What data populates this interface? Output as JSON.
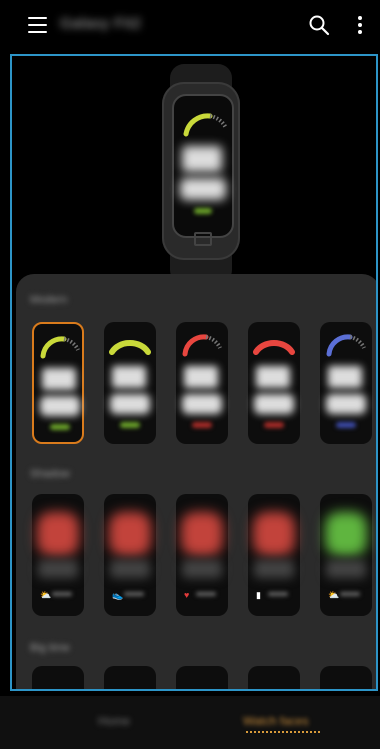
{
  "appbar": {
    "title": "Galaxy Fit2",
    "menu_icon": "hamburger-menu-icon",
    "search_icon": "search-icon",
    "more_icon": "more-vertical-icon"
  },
  "preview": {
    "time_top": "10",
    "time_bottom": "08",
    "accent": "#c9d93a"
  },
  "sections": [
    {
      "title": "Modern",
      "faces": [
        {
          "accent": "#c9d93a",
          "bar": "#6aa12a",
          "selected": true
        },
        {
          "accent": "#c9d93a",
          "bar": "#6aa12a",
          "selected": false
        },
        {
          "accent": "#e8463f",
          "bar": "#a82c28",
          "selected": false
        },
        {
          "accent": "#e8463f",
          "bar": "#a82c28",
          "selected": false
        },
        {
          "accent": "#5b6fd6",
          "bar": "#3c4aa8",
          "selected": false
        }
      ]
    },
    {
      "title": "Shadow",
      "faces": [
        {
          "blob": "#c2433b",
          "icon": "weather-icon",
          "glyph": "⛅"
        },
        {
          "blob": "#c2433b",
          "icon": "steps-icon",
          "glyph": "👟"
        },
        {
          "blob": "#c2433b",
          "icon": "heart-icon",
          "glyph": "♥"
        },
        {
          "blob": "#c2433b",
          "icon": "battery-icon",
          "glyph": "▮"
        },
        {
          "blob": "#5fb53f",
          "icon": "weather-icon",
          "glyph": "⛅"
        }
      ]
    },
    {
      "title": "Big time",
      "faces": [
        {},
        {},
        {},
        {},
        {}
      ]
    }
  ],
  "bottom_nav": {
    "tabs": [
      {
        "label": "Home",
        "active": false
      },
      {
        "label": "Watch faces",
        "active": true
      }
    ],
    "active_color": "#d99b3a"
  },
  "colors": {
    "outline": "#2d95c8",
    "selected": "#d97b1c",
    "sheet": "#2b2b2b"
  }
}
